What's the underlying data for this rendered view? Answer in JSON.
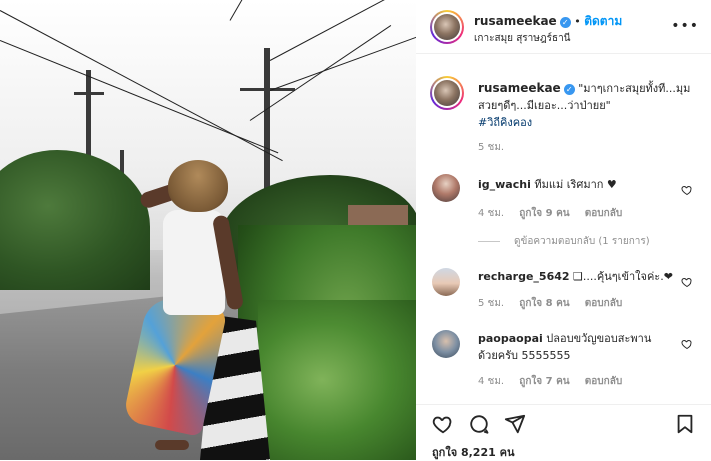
{
  "post": {
    "author": "rusameekae",
    "follow_label": "ติดตาม",
    "location": "เกาะสมุย สุราษฎร์ธานี",
    "caption": "\"มาๆเกาะสมุยทั้งที...มุมสวยๆดีๆ...มีเยอะ...ว่าป่ายย\"",
    "hashtag": "#วิถีคิงคอง",
    "caption_time": "5 ชม.",
    "likes_label": "ถูกใจ 8,221 คน"
  },
  "comments": [
    {
      "user": "ig_wachi",
      "text": "ทีมแม่ เริศมาก ♥",
      "time": "4 ชม.",
      "likes": "ถูกใจ 9 คน",
      "reply": "ตอบกลับ"
    },
    {
      "user": "recharge_5642",
      "text": "❑....คุ้นๆเข้าใจค่ะ.❤",
      "time": "5 ชม.",
      "likes": "ถูกใจ 8 คน",
      "reply": "ตอบกลับ"
    },
    {
      "user": "paopaopai",
      "text": "ปลอบขวัญขอบสะพาน ด้วยครับ 5555555",
      "time": "4 ชม.",
      "likes": "ถูกใจ 7 คน",
      "reply": "ตอบกลับ"
    }
  ],
  "view_replies": "ดูข้อความตอบกลับ (1 รายการ)",
  "icons": {
    "verified": "verified-badge-icon",
    "more": "more-options-icon",
    "like": "heart-icon",
    "comment": "comment-icon",
    "share": "paper-plane-icon",
    "save": "bookmark-icon"
  },
  "colors": {
    "accent": "#0095f6",
    "verified": "#3897f0",
    "hashtag": "#00376b",
    "muted": "#8e8e8e"
  }
}
